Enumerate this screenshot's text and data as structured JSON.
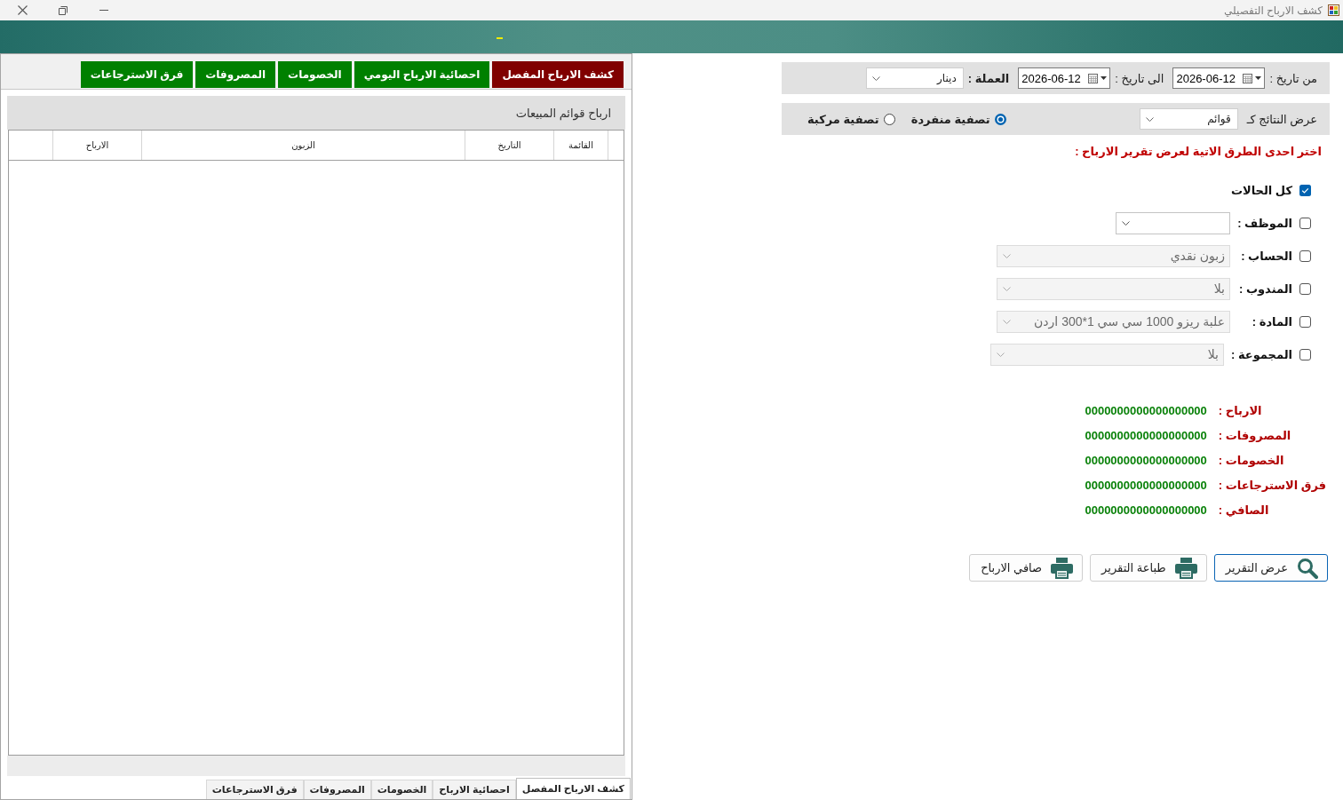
{
  "window": {
    "title": "كشف الارباح التفصيلي"
  },
  "report_tabs": [
    {
      "label": "كشف الارباح المفصل",
      "selected": true
    },
    {
      "label": "احصائية الارباح اليومي",
      "selected": false
    },
    {
      "label": "الخصومات",
      "selected": false
    },
    {
      "label": "المصروفات",
      "selected": false
    },
    {
      "label": "فرق الاسترجاعات",
      "selected": false
    }
  ],
  "sales_panel": {
    "title": "ارباح قوائم المبيعات",
    "columns": [
      "القائمة",
      "التاريخ",
      "الزبون",
      "الارباح"
    ]
  },
  "bottom_tabs": [
    {
      "label": "كشف الارباح المفصل",
      "selected": true
    },
    {
      "label": "احصائية الارباح",
      "selected": false
    },
    {
      "label": "الخصومات",
      "selected": false
    },
    {
      "label": "المصروفات",
      "selected": false
    },
    {
      "label": "فرق الاسترجاعات",
      "selected": false
    }
  ],
  "date_filter": {
    "from_label": "من تاريخ :",
    "from_date": "2026-06-12",
    "to_label": "الى تاريخ :",
    "to_date": "2026-06-12",
    "currency_label": "العملة :",
    "currency": "دينار"
  },
  "display": {
    "label": "عرض النتائج كـ",
    "value": "قوائم",
    "options": [
      {
        "label": "تصفية منفردة",
        "selected": true
      },
      {
        "label": "تصفية مركبة",
        "selected": false
      }
    ]
  },
  "instruction": "اختر احدى الطرق الاتية لعرض تقرير الارباح :",
  "filters": [
    {
      "kind": "check",
      "label": "كل الحالات",
      "checked": true
    },
    {
      "kind": "select",
      "label": "الموظف :",
      "checked": false,
      "disabled": false
    },
    {
      "kind": "select",
      "label": "الحساب :",
      "checked": false,
      "disabled": true,
      "value": "زبون نقدي"
    },
    {
      "kind": "select",
      "label": "المندوب :",
      "checked": false,
      "disabled": true,
      "value": "بلا"
    },
    {
      "kind": "select",
      "label": "المادة :",
      "checked": false,
      "disabled": true,
      "value": "علبة ريزو 1000 سي سي 1*300 اردن"
    },
    {
      "kind": "select",
      "label": "المجموعة :",
      "checked": false,
      "disabled": true,
      "value": "بلا"
    }
  ],
  "totals": [
    {
      "label": "الارباح :",
      "value": "0000000000000000000"
    },
    {
      "label": "المصروفات :",
      "value": "0000000000000000000"
    },
    {
      "label": "الخصومات :",
      "value": "0000000000000000000"
    },
    {
      "label": "فرق الاسترجاعات :",
      "value": "0000000000000000000"
    },
    {
      "label": "الصافي :",
      "value": "0000000000000000000"
    }
  ],
  "actions": [
    {
      "kind": "search",
      "label": "عرض التقرير",
      "focused": true
    },
    {
      "kind": "print",
      "label": "طباعة التقرير",
      "focused": false
    },
    {
      "kind": "print",
      "label": "صافي الارباح",
      "focused": false
    }
  ]
}
